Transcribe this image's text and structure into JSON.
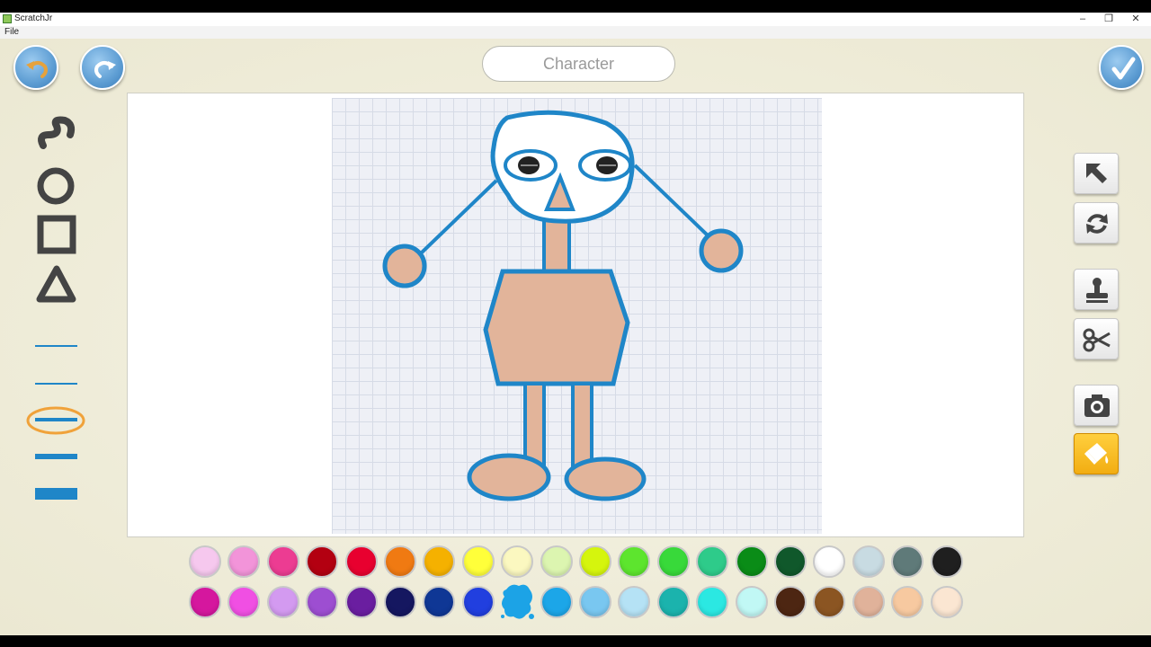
{
  "window": {
    "title": "ScratchJr",
    "menu": [
      "File"
    ],
    "controls": [
      "–",
      "❐",
      "✕"
    ]
  },
  "header": {
    "undo_icon": "undo-arrow-icon",
    "redo_icon": "redo-arrow-icon",
    "name_field_value": "Character",
    "done_icon": "checkmark-icon"
  },
  "left_tools": [
    "freehand-line-icon",
    "circle-icon",
    "rectangle-icon",
    "triangle-icon"
  ],
  "line_widths": [
    1,
    2,
    4,
    6,
    9
  ],
  "selected_line_width_index": 2,
  "right_tools": [
    {
      "name": "select-arrow",
      "icon": "arrow-pointer-icon"
    },
    {
      "name": "rotate",
      "icon": "rotate-icon"
    },
    {
      "name": "stamp",
      "icon": "stamp-icon"
    },
    {
      "name": "cut",
      "icon": "scissors-icon"
    },
    {
      "name": "camera",
      "icon": "camera-icon"
    },
    {
      "name": "fill",
      "icon": "paint-bucket-icon",
      "active": true
    }
  ],
  "palette_row1": [
    "#f6c8ee",
    "#f294d9",
    "#ec3c92",
    "#b30011",
    "#e8002f",
    "#f07a12",
    "#f5b100",
    "#ffff3a",
    "#fbf8c0",
    "#dcf5b0",
    "#d5f50d",
    "#5de52e",
    "#38d93a",
    "#2ecb8a",
    "#0a8c17",
    "#10582b",
    "#ffffff",
    "#c8dbe2",
    "#5f7a79",
    "#1f1f1f"
  ],
  "palette_row2": [
    "#d5179e",
    "#f04fe3",
    "#d39af0",
    "#9d4ed1",
    "#6a1ea0",
    "#151760",
    "#0f3795",
    "#213fdf",
    "#1ca3e6",
    "#1ca6e8",
    "#79c7f0",
    "#b5e2f5",
    "#1bb3ad",
    "#2be8e2",
    "#c1f8f5",
    "#4d2612",
    "#8b5522",
    "#e0b29a",
    "#f7c9a0",
    "#fbe6d2"
  ],
  "selected_color": "#1ca3e6",
  "selected_color_index": 8
}
